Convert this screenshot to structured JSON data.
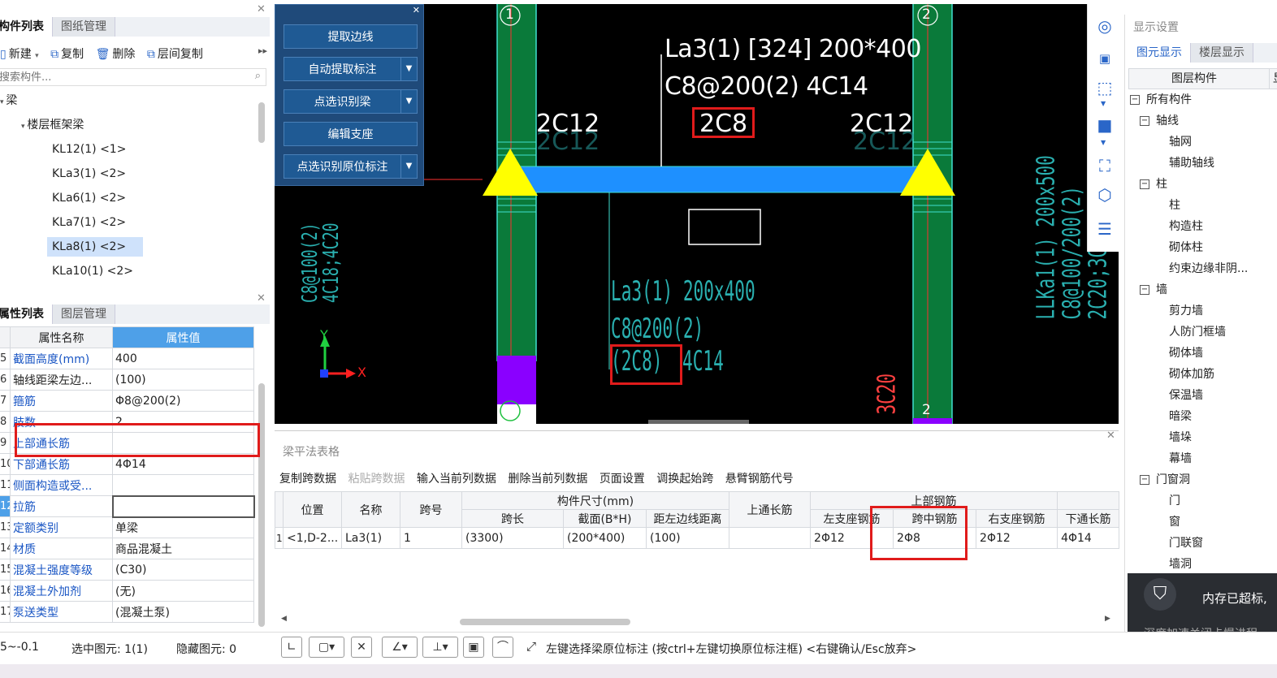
{
  "left_top_panel": {
    "tabs": [
      "构件列表",
      "图纸管理"
    ],
    "toolbar": {
      "new": "新建",
      "copy": "复制",
      "delete": "删除",
      "floor_copy": "层间复制"
    },
    "search_placeholder": "搜索构件...",
    "tree": {
      "root": "梁",
      "group": "楼层框架梁",
      "items": [
        "KL12(1) <1>",
        "KLa3(1) <2>",
        "KLa6(1) <2>",
        "KLa7(1) <2>",
        "KLa8(1) <2>",
        "KLa10(1) <2>"
      ],
      "selected_index": 4
    }
  },
  "properties_panel": {
    "tabs": [
      "属性列表",
      "图层管理"
    ],
    "headers": [
      "属性名称",
      "属性值"
    ],
    "rows": [
      {
        "idx": "5",
        "name": "截面高度(mm)",
        "value": "400"
      },
      {
        "idx": "6",
        "name": "轴线距梁左边...",
        "value": "(100)"
      },
      {
        "idx": "7",
        "name": "箍筋",
        "value": "Φ8@200(2)"
      },
      {
        "idx": "8",
        "name": "肢数",
        "value": "2"
      },
      {
        "idx": "9",
        "name": "上部通长筋",
        "value": ""
      },
      {
        "idx": "10",
        "name": "下部通长筋",
        "value": "4Φ14"
      },
      {
        "idx": "11",
        "name": "侧面构造或受...",
        "value": ""
      },
      {
        "idx": "12",
        "name": "拉筋",
        "value": ""
      },
      {
        "idx": "13",
        "name": "定额类别",
        "value": "单梁"
      },
      {
        "idx": "14",
        "name": "材质",
        "value": "商品混凝土"
      },
      {
        "idx": "15",
        "name": "混凝土强度等级",
        "value": "(C30)"
      },
      {
        "idx": "16",
        "name": "混凝土外加剂",
        "value": "(无)"
      },
      {
        "idx": "17",
        "name": "泵送类型",
        "value": "(混凝土泵)"
      }
    ]
  },
  "cad_tools": {
    "buttons": [
      "提取边线",
      "自动提取标注",
      "点选识别梁",
      "编辑支座",
      "点选识别原位标注"
    ]
  },
  "cad_canvas": {
    "axis_labels": [
      "1",
      "2",
      "2"
    ],
    "beam_label": "La3(1) [324] 200*400",
    "stirrup_label": "C8@200(2) 4C14",
    "mid_rebar": "2C8",
    "left_rebar": "2C12",
    "right_rebar": "2C12",
    "left_rebar_ghost": "2C12",
    "right_rebar_ghost": "2C12",
    "drawing_text_1": "La3(1) 200x400",
    "drawing_text_2": "C8@200(2)",
    "drawing_text_3": "(2C8)",
    "drawing_text_3b": "4C14",
    "left_vertical_1": "C8@100(2)",
    "left_vertical_2": "4C18;4C20",
    "right_vertical_1": "LLKa1(1) 200x500",
    "right_vertical_2": "C8@100/200(2)",
    "right_vertical_3": "2C20;3C",
    "bottom_vertical": "3C20",
    "ucs_y": "Y",
    "ucs_x": "X"
  },
  "beam_table": {
    "title": "梁平法表格",
    "toolbar": [
      "复制跨数据",
      "粘贴跨数据",
      "输入当前列数据",
      "删除当前列数据",
      "页面设置",
      "调换起始跨",
      "悬臂钢筋代号"
    ],
    "headers_top": [
      "位置",
      "名称",
      "跨号",
      "构件尺寸(mm)",
      "上通长筋",
      "上部钢筋"
    ],
    "headers_sub": [
      "跨长",
      "截面(B*H)",
      "距左边线距离",
      "左支座钢筋",
      "跨中钢筋",
      "右支座钢筋",
      "下通长筋"
    ],
    "row": [
      "1",
      "<1,D-2...",
      "La3(1)",
      "1",
      "(3300)",
      "(200*400)",
      "(100)",
      "",
      "2Φ12",
      "2Φ8",
      "2Φ12",
      "4Φ14"
    ]
  },
  "display_settings": {
    "title": "显示设置",
    "tabs": [
      "图元显示",
      "楼层显示"
    ],
    "header": "图层构件",
    "header2": "显",
    "rows": [
      {
        "level": 0,
        "exp": true,
        "label": "所有构件"
      },
      {
        "level": 1,
        "exp": true,
        "label": "轴线"
      },
      {
        "level": 2,
        "exp": false,
        "label": "轴网"
      },
      {
        "level": 2,
        "exp": false,
        "label": "辅助轴线"
      },
      {
        "level": 1,
        "exp": true,
        "label": "柱"
      },
      {
        "level": 2,
        "exp": false,
        "label": "柱"
      },
      {
        "level": 2,
        "exp": false,
        "label": "构造柱"
      },
      {
        "level": 2,
        "exp": false,
        "label": "砌体柱"
      },
      {
        "level": 2,
        "exp": false,
        "label": "约束边缘非阴..."
      },
      {
        "level": 1,
        "exp": true,
        "label": "墙"
      },
      {
        "level": 2,
        "exp": false,
        "label": "剪力墙"
      },
      {
        "level": 2,
        "exp": false,
        "label": "人防门框墙"
      },
      {
        "level": 2,
        "exp": false,
        "label": "砌体墙"
      },
      {
        "level": 2,
        "exp": false,
        "label": "砌体加筋"
      },
      {
        "level": 2,
        "exp": false,
        "label": "保温墙"
      },
      {
        "level": 2,
        "exp": false,
        "label": "暗梁"
      },
      {
        "level": 2,
        "exp": false,
        "label": "墙垛"
      },
      {
        "level": 2,
        "exp": false,
        "label": "幕墙"
      },
      {
        "level": 1,
        "exp": true,
        "label": "门窗洞"
      },
      {
        "level": 2,
        "exp": false,
        "label": "门"
      },
      {
        "level": 2,
        "exp": false,
        "label": "窗"
      },
      {
        "level": 2,
        "exp": false,
        "label": "门联窗"
      },
      {
        "level": 2,
        "exp": false,
        "label": "墙洞"
      }
    ]
  },
  "toast": {
    "title": "内存已超标,",
    "sub": "深度加速关闭卡慢进程"
  },
  "status": {
    "coord": "5~-0.1",
    "selected": "选中图元: 1(1)",
    "hidden": "隐藏图元: 0",
    "hint": "左键选择梁原位标注 (按ctrl+左键切换原位标注框) <右键确认/Esc放弃>"
  },
  "colors": {
    "accent": "#4ea0e8",
    "highlight": "#e01b1b",
    "beam": "#1e90ff",
    "column": "#0a7a3a",
    "support": "#ffff00"
  }
}
